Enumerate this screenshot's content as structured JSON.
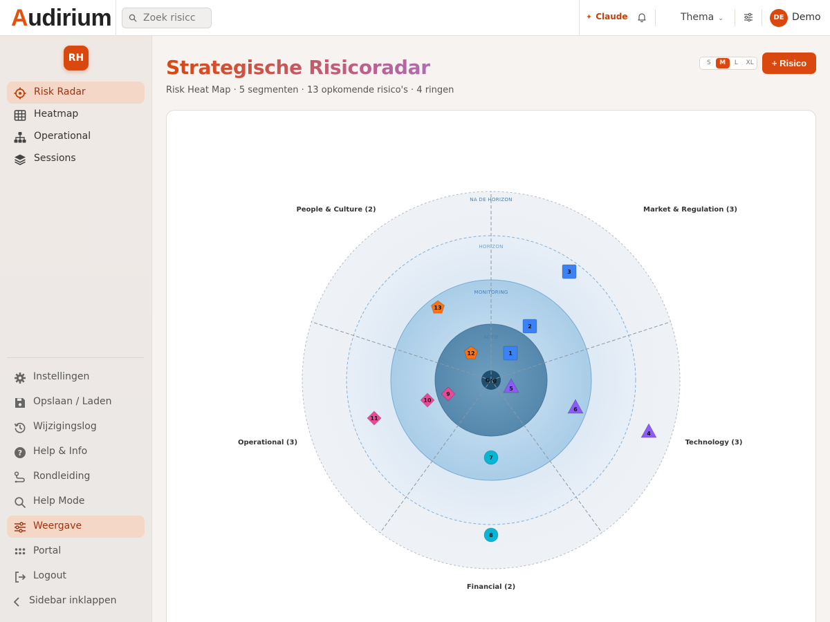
{
  "app": {
    "logo_prefix": "A",
    "logo_rest": "udirium",
    "search_placeholder": "Zoek risicc",
    "claude_label": "Claude",
    "theme_label": "Thema",
    "user_initials": "DE",
    "user_name": "Demo",
    "brand_color": "#d9480f"
  },
  "sidebar": {
    "avatar": "RH",
    "nav": [
      {
        "label": "Risk Radar",
        "icon": "crosshair-icon",
        "active": true
      },
      {
        "label": "Heatmap",
        "icon": "grid-icon",
        "active": false
      },
      {
        "label": "Operational",
        "icon": "hierarchy-icon",
        "active": false
      },
      {
        "label": "Sessions",
        "icon": "layers-icon",
        "active": false
      }
    ],
    "bottom": [
      {
        "label": "Instellingen",
        "icon": "gear-icon",
        "active": false
      },
      {
        "label": "Opslaan / Laden",
        "icon": "save-icon",
        "active": false
      },
      {
        "label": "Wijzigingslog",
        "icon": "history-icon",
        "active": false
      },
      {
        "label": "Help & Info",
        "icon": "help-icon",
        "active": false
      },
      {
        "label": "Rondleiding",
        "icon": "route-icon",
        "active": false
      },
      {
        "label": "Help Mode",
        "icon": "search-icon",
        "active": false
      },
      {
        "label": "Weergave",
        "icon": "sliders-icon",
        "active": true
      },
      {
        "label": "Portal",
        "icon": "dots-grid-icon",
        "active": false
      },
      {
        "label": "Logout",
        "icon": "logout-icon",
        "active": false
      },
      {
        "label": "Sidebar inklappen",
        "icon": "chevron-left-icon",
        "active": false
      }
    ]
  },
  "main": {
    "title": "Strategische Risicoradar",
    "subtitle": "Risk Heat Map · 5 segmenten · 13 opkomende risico's · 4 ringen",
    "sizes": [
      "S",
      "M",
      "L",
      "XL"
    ],
    "active_size": "M",
    "add_label": "+ Risico"
  },
  "radar": {
    "center_label": "Org",
    "rings": [
      "ACTIE",
      "MONITORING",
      "HORIZON",
      "NA DE HORIZON"
    ],
    "segments": [
      {
        "label": "Market & Regulation (3)"
      },
      {
        "label": "Technology (3)"
      },
      {
        "label": "Financial (2)"
      },
      {
        "label": "Operational (3)"
      },
      {
        "label": "People & Culture (2)"
      }
    ],
    "risks": [
      {
        "id": "1",
        "segment": "Market & Regulation",
        "ring": "ACTIE",
        "shape": "square",
        "color": "#3b82f6"
      },
      {
        "id": "2",
        "segment": "Market & Regulation",
        "ring": "MONITORING",
        "shape": "square",
        "color": "#3b82f6"
      },
      {
        "id": "3",
        "segment": "Market & Regulation",
        "ring": "HORIZON",
        "shape": "square",
        "color": "#3b82f6"
      },
      {
        "id": "4",
        "segment": "Technology",
        "ring": "NA DE HORIZON",
        "shape": "triangle",
        "color": "#8b5cf6"
      },
      {
        "id": "5",
        "segment": "Technology",
        "ring": "ACTIE",
        "shape": "triangle",
        "color": "#8b5cf6"
      },
      {
        "id": "6",
        "segment": "Technology",
        "ring": "HORIZON",
        "shape": "triangle",
        "color": "#8b5cf6"
      },
      {
        "id": "7",
        "segment": "Financial",
        "ring": "MONITORING",
        "shape": "circle",
        "color": "#06b6d4"
      },
      {
        "id": "8",
        "segment": "Financial",
        "ring": "NA DE HORIZON",
        "shape": "circle",
        "color": "#06b6d4"
      },
      {
        "id": "9",
        "segment": "Operational",
        "ring": "ACTIE",
        "shape": "diamond",
        "color": "#ec4899"
      },
      {
        "id": "10",
        "segment": "Operational",
        "ring": "MONITORING",
        "shape": "diamond",
        "color": "#ec4899"
      },
      {
        "id": "11",
        "segment": "Operational",
        "ring": "HORIZON",
        "shape": "diamond",
        "color": "#ec4899"
      },
      {
        "id": "12",
        "segment": "People & Culture",
        "ring": "ACTIE",
        "shape": "pentagon",
        "color": "#f97316"
      },
      {
        "id": "13",
        "segment": "People & Culture",
        "ring": "MONITORING",
        "shape": "pentagon",
        "color": "#f97316"
      }
    ]
  }
}
